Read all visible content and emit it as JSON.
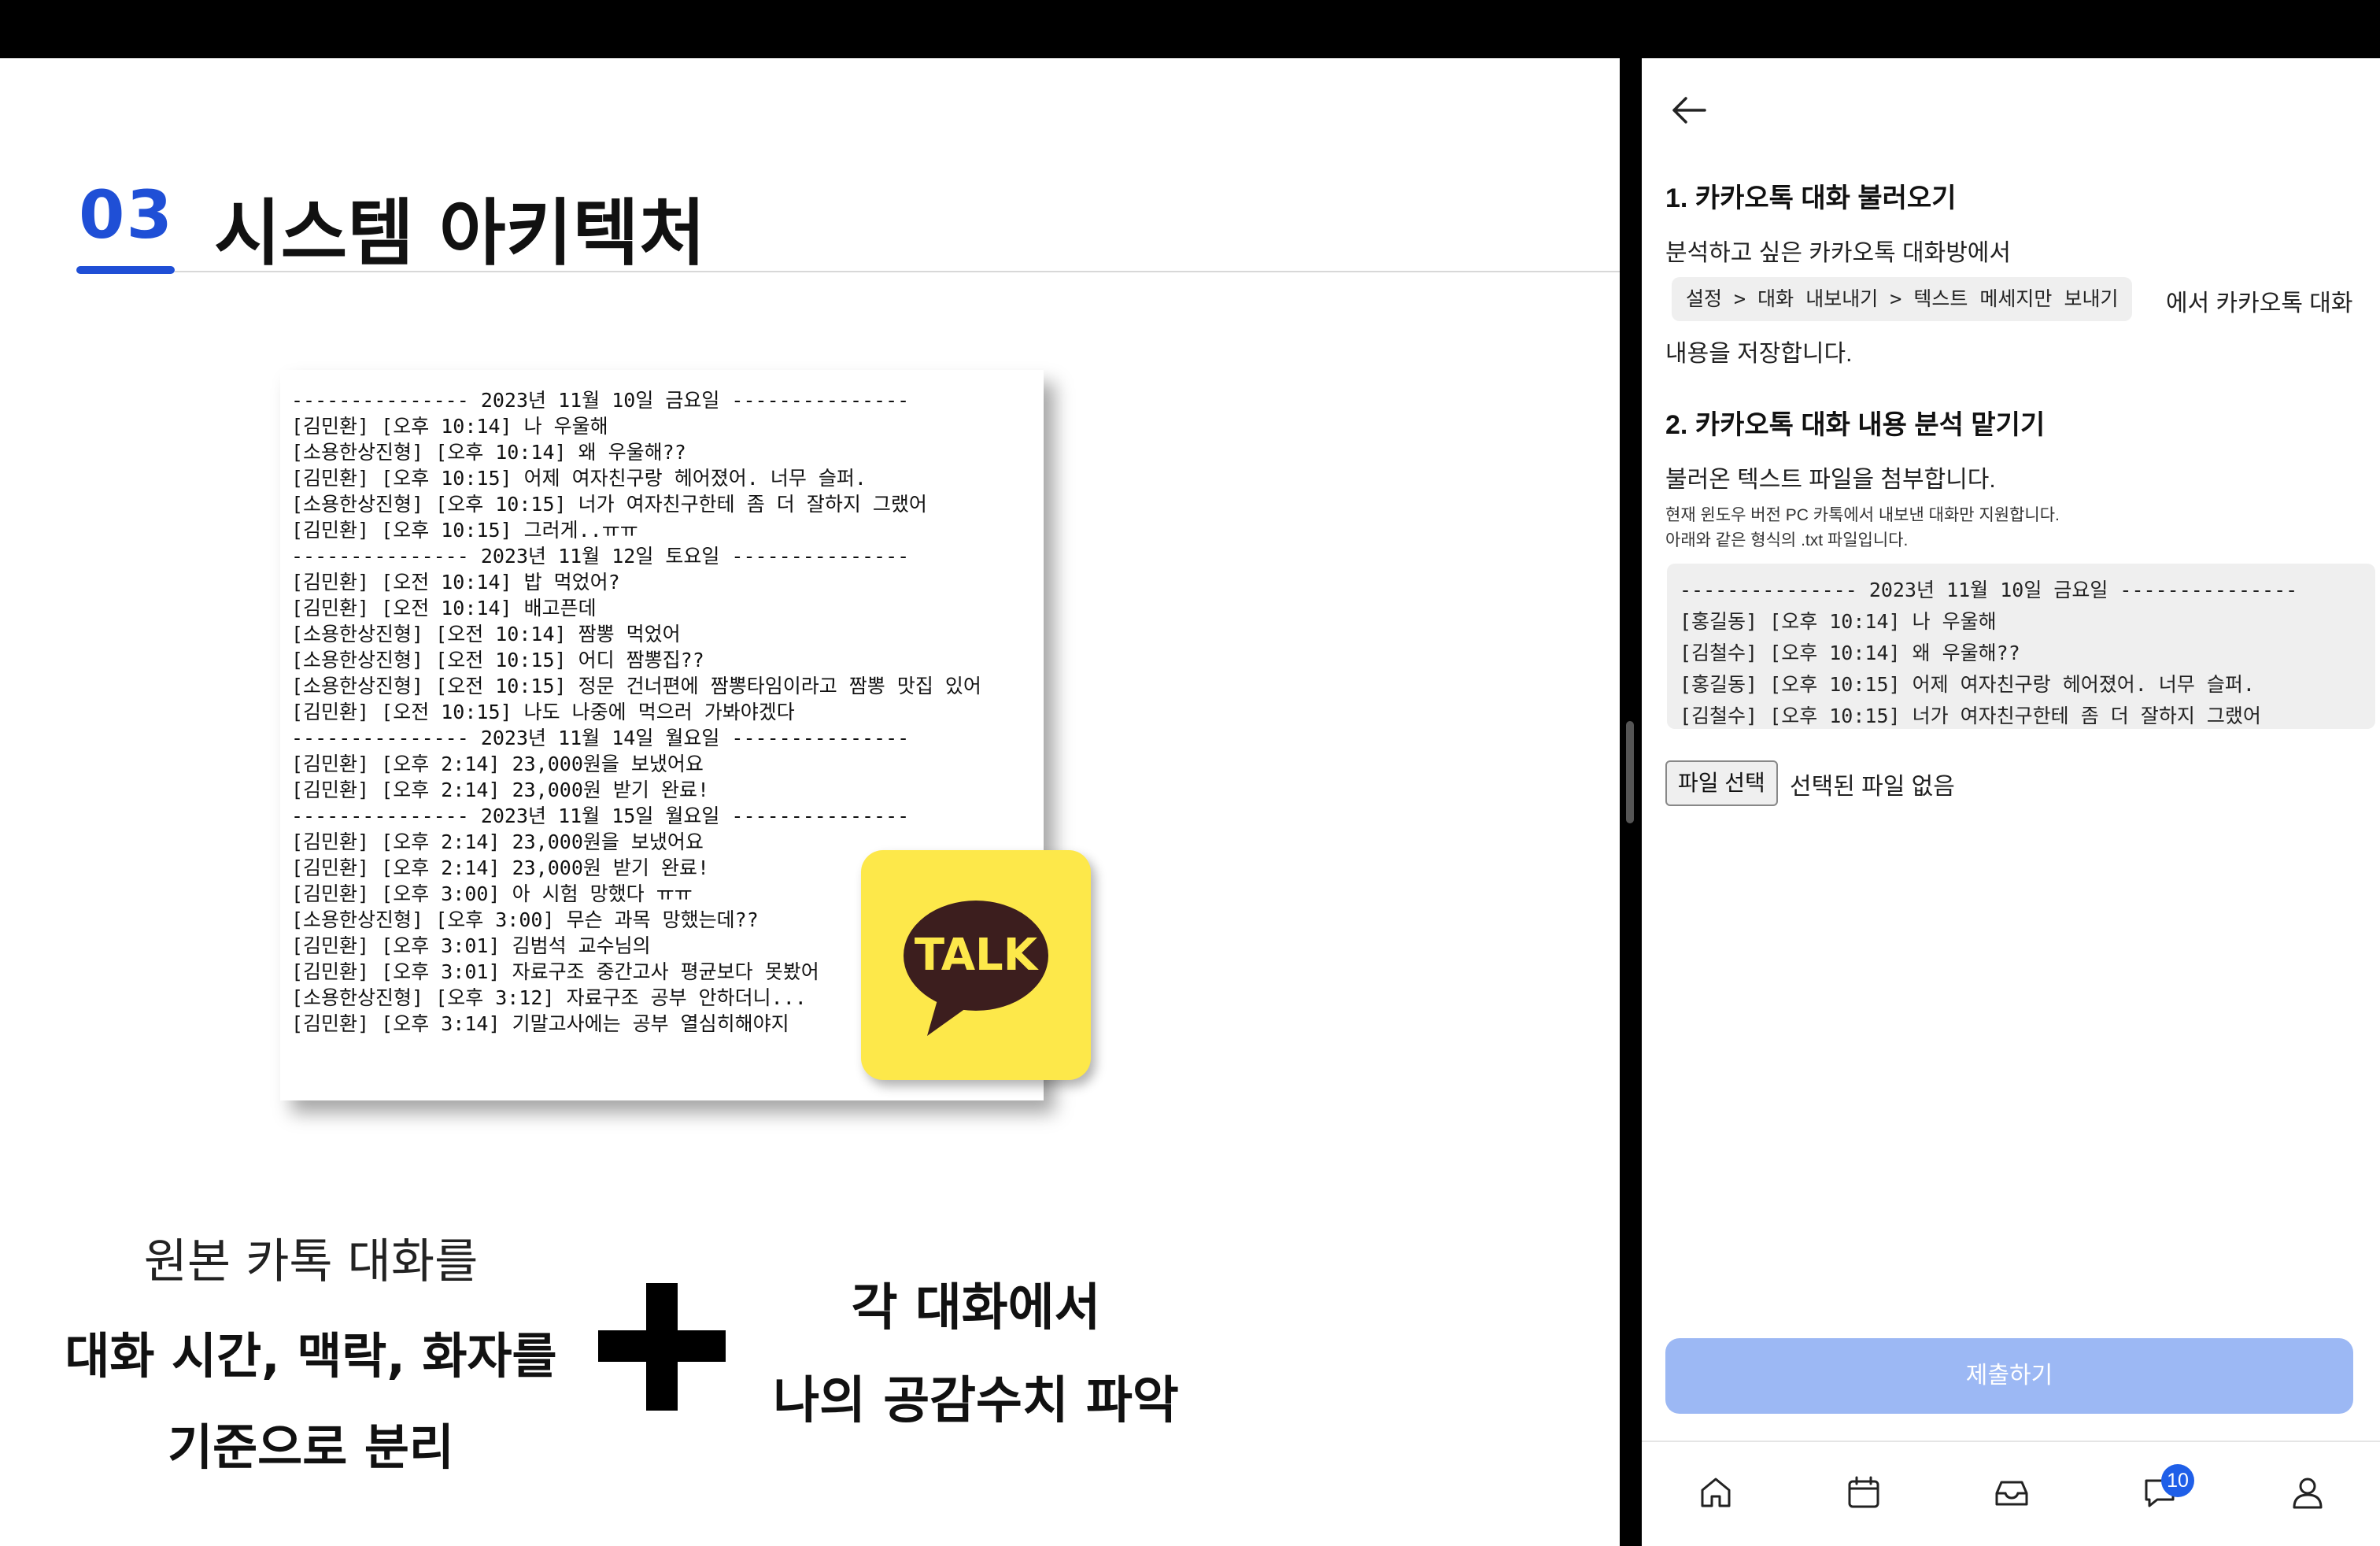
{
  "slide": {
    "number": "03",
    "title": "시스템 아키텍처",
    "chat_log": [
      "--------------- 2023년 11월 10일 금요일 ---------------",
      "[김민환] [오후 10:14] 나 우울해",
      "[소용한상진형] [오후 10:14] 왜 우울해??",
      "[김민환] [오후 10:15] 어제 여자친구랑 헤어졌어. 너무 슬퍼.",
      "[소용한상진형] [오후 10:15] 너가 여자친구한테 좀 더 잘하지 그랬어",
      "[김민환] [오후 10:15] 그러게..ㅠㅠ",
      "--------------- 2023년 11월 12일 토요일 ---------------",
      "[김민환] [오전 10:14] 밥 먹었어?",
      "[김민환] [오전 10:14] 배고픈데",
      "[소용한상진형] [오전 10:14] 짬뽕 먹었어",
      "[소용한상진형] [오전 10:15] 어디 짬뽕집??",
      "[소용한상진형] [오전 10:15] 정문 건너편에 짬뽕타임이라고 짬뽕 맛집 있어",
      "[김민환] [오전 10:15] 나도 나중에 먹으러 가봐야겠다",
      "--------------- 2023년 11월 14일 월요일 ---------------",
      "[김민환] [오후 2:14] 23,000원을 보냈어요",
      "[김민환] [오후 2:14] 23,000원 받기 완료!",
      "--------------- 2023년 11월 15일 월요일 ---------------",
      "[김민환] [오후 2:14] 23,000원을 보냈어요",
      "[김민환] [오후 2:14] 23,000원 받기 완료!",
      "[김민환] [오후 3:00] 아 시험 망했다 ㅠㅠ",
      "[소용한상진형] [오후 3:00] 무슨 과목 망했는데??",
      "[김민환] [오후 3:01] 김범석 교수님의",
      "[김민환] [오후 3:01] 자료구조 중간고사 평균보다 못봤어",
      "[소용한상진형] [오후 3:12] 자료구조 공부 안하더니...",
      "[김민환] [오후 3:14] 기말고사에는 공부 열심히해야지"
    ],
    "logo_text": "TALK",
    "caption_left": [
      "원본 카톡 대화를",
      "대화 시간, 맥락, 화자를",
      "기준으로 분리"
    ],
    "caption_right": [
      "각 대화에서",
      "나의 공감수치 파악"
    ]
  },
  "app": {
    "step1_title": "1. 카카오톡 대화 불러오기",
    "step1_desc": "분석하고 싶은 카카오톡 대화방에서",
    "step1_path": "설정 > 대화 내보내기 > 텍스트 메세지만 보내기",
    "step1_after": "에서 카카오톡 대화",
    "step1_after2": "내용을 저장합니다.",
    "step2_title": "2. 카카오톡 대화 내용 분석 맡기기",
    "step2_desc": "불러온 텍스트 파일을 첨부합니다.",
    "step2_note1": "현재 윈도우 버전 PC 카톡에서 내보낸 대화만 지원합니다.",
    "step2_note2": "아래와 같은 형식의 .txt 파일입니다.",
    "sample_lines": [
      "--------------- 2023년 11월 10일 금요일 ---------------",
      "[홍길동] [오후 10:14] 나 우울해",
      "[김철수] [오후 10:14] 왜 우울해??",
      "[홍길동] [오후 10:15] 어제 여자친구랑 헤어졌어. 너무 슬퍼.",
      "[김철수] [오후 10:15] 너가 여자친구한테 좀 더 잘하지 그랬어"
    ],
    "file_button": "파일 선택",
    "file_status": "선택된 파일 없음",
    "submit_label": "제출하기",
    "nav": {
      "items": [
        "home-icon",
        "calendar-icon",
        "inbox-icon",
        "chat-icon",
        "profile-icon"
      ],
      "chat_badge": "10"
    }
  },
  "colors": {
    "accent": "#1f4fd6",
    "submit_disabled": "#9cb8f4",
    "kakao_yellow": "#fde84a",
    "kakao_brown": "#3c1e1e",
    "badge": "#1f5fe8"
  }
}
